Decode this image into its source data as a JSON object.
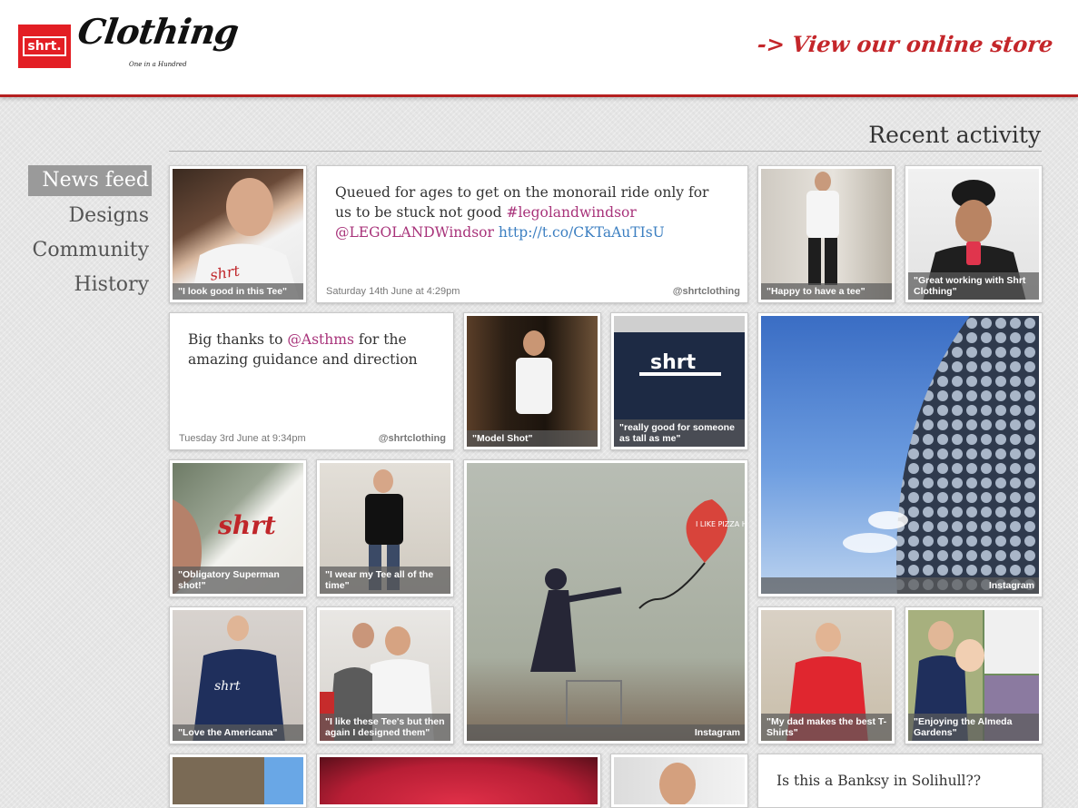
{
  "header": {
    "logo_box_text": "shrt.",
    "logo_script": "Clothing",
    "logo_tagline": "One in a Hundred",
    "store_arrow": "->",
    "store_link": "View our online store"
  },
  "section_title": "Recent activity",
  "nav": {
    "items": [
      {
        "label": "News feed",
        "active": true
      },
      {
        "label": "Designs"
      },
      {
        "label": "Community"
      },
      {
        "label": "History"
      }
    ]
  },
  "feed": {
    "tweets": [
      {
        "text_plain": "Queued for ages to get on the monorail ride only for us to be stuck not good",
        "hashtag": "#legolandwindsor",
        "mention": "@LEGOLANDWindsor",
        "link": "http://t.co/CKTaAuTIsU",
        "date": "Saturday 14th June at 4:29pm",
        "handle": "@shrtclothing"
      },
      {
        "text_before": "Big thanks to",
        "mention": "@Asthms",
        "text_after": "for the amazing guidance and direction",
        "date": "Tuesday 3rd June at 9:34pm",
        "handle": "@shrtclothing"
      },
      {
        "text_plain": "Is this a Banksy in Solihull??"
      }
    ],
    "captions": {
      "look_good": "\"I look good in this Tee\"",
      "happy": "\"Happy to have a tee\"",
      "great_working": "\"Great working with Shrt Clothing\"",
      "model_shot": "\"Model Shot\"",
      "tall": "\"really good for someone as tall as me\"",
      "superman": "\"Obligatory Superman shot!\"",
      "wear_all": "\"I wear my Tee all of the time\"",
      "instagram_1": "Instagram",
      "instagram_2": "Instagram",
      "americana": "\"Love the Americana\"",
      "designed": "\"I like these Tee's but then again I designed them\"",
      "dad": "\"My dad makes the best T-Shirts\"",
      "almeda": "\"Enjoying the Almeda Gardens\""
    },
    "photo_text": {
      "balloon": "I LIKE PIZZA HUT",
      "shirt_logo": "shrt"
    }
  },
  "colors": {
    "brand_red": "#e31e24",
    "accent_red": "#c4262a",
    "hashtag": "#a8337a",
    "link": "#3c7fc1"
  }
}
